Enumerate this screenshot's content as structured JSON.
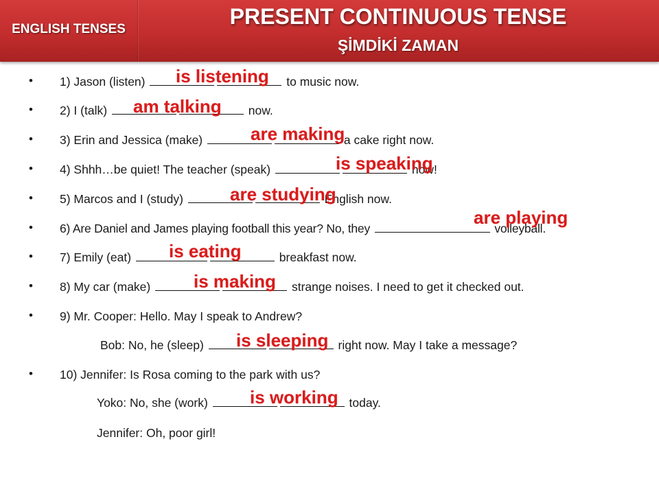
{
  "header": {
    "series_title": "ENGLISH TENSES",
    "main_title": "PRESENT CONTINUOUS TENSE",
    "sub_title": "ŞİMDİKİ ZAMAN"
  },
  "colors": {
    "header_red": "#c32d2d",
    "answer_red": "#d91c1c"
  },
  "exercises": [
    {
      "pre": "1) Jason (listen)",
      "post": "to music now.",
      "answer": "is  listening"
    },
    {
      "pre": "2) I (talk)",
      "post": "now.",
      "answer": "am talking"
    },
    {
      "pre": "3) Erin and Jessica (make)",
      "post": "a cake right now.",
      "answer": "are making"
    },
    {
      "pre": "4) Shhh…be quiet! The teacher (speak)",
      "post": "now!",
      "answer": "is speaking"
    },
    {
      "pre": "5) Marcos and I (study)",
      "post": "English now.",
      "answer": "are studying"
    },
    {
      "pre": "6) Are Daniel and James playing football this year? No, they",
      "post": "volleyball.",
      "answer": "are playing"
    },
    {
      "pre": "7) Emily (eat)",
      "post": "breakfast now.",
      "answer": "is eating"
    },
    {
      "pre": "8) My car (make)",
      "post": "strange noises. I need to get it checked  out.",
      "answer": "is making"
    },
    {
      "pre": "9) Mr. Cooper: Hello. May I speak to Andrew?"
    },
    {
      "pre": "Bob: No, he (sleep)",
      "post": "right now. May I take a message?",
      "answer": "is sleeping"
    },
    {
      "pre": "10) Jennifer: Is Rosa coming to the park with us?"
    },
    {
      "pre": "Yoko: No, she (work)",
      "post": "today.",
      "answer": "is working"
    },
    {
      "pre": "Jennifer: Oh, poor girl!"
    }
  ]
}
